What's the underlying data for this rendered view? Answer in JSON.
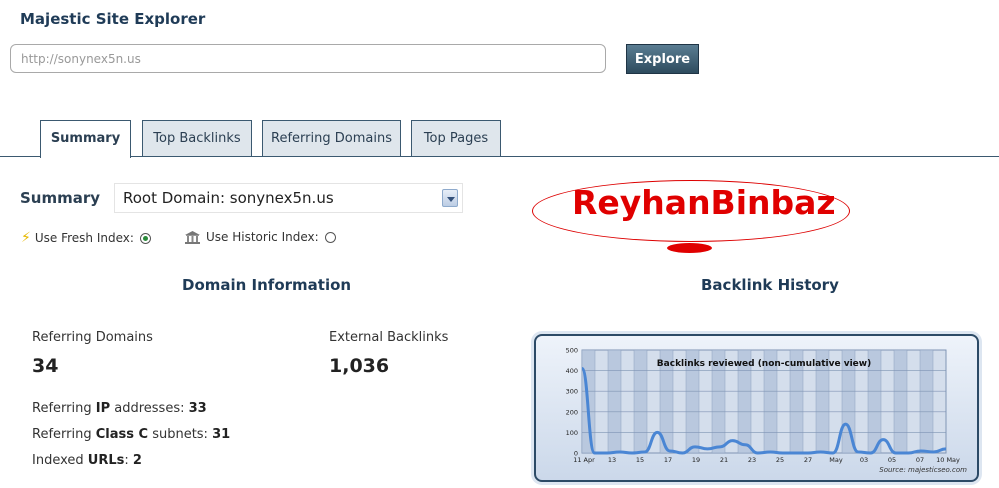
{
  "app": {
    "title": "Majestic Site Explorer"
  },
  "search": {
    "placeholder": "http://sonynex5n.us",
    "button_label": "Explore"
  },
  "tabs": [
    {
      "label": "Summary",
      "active": true
    },
    {
      "label": "Top Backlinks",
      "active": false
    },
    {
      "label": "Referring Domains",
      "active": false
    },
    {
      "label": "Top Pages",
      "active": false
    }
  ],
  "summary": {
    "label": "Summary",
    "selected_option": "Root Domain: sonynex5n.us",
    "fresh_index_label": "Use Fresh Index:",
    "historic_index_label": "Use Historic Index:",
    "fresh_selected": true
  },
  "watermark": {
    "text": "ReyhanBinbaz",
    "color": "#e00000"
  },
  "domain_info": {
    "title": "Domain Information",
    "referring_domains_label": "Referring Domains",
    "referring_domains_value": "34",
    "external_backlinks_label": "External Backlinks",
    "external_backlinks_value": "1,036",
    "ip_label": "Referring",
    "ip_bold": "IP",
    "ip_label2": "addresses:",
    "ip_value": "33",
    "classc_label": "Referring",
    "classc_bold": "Class C",
    "classc_label2": "subnets:",
    "classc_value": "31",
    "indexed_label": "Indexed",
    "indexed_bold": "URLs",
    "indexed_value": "2"
  },
  "backlink_history": {
    "title": "Backlink History",
    "source": "Source: majesticseo.com"
  },
  "colors": {
    "accent": "#1f3b57",
    "line": "#4a86d4",
    "button": "#3d5c70"
  },
  "chart_data": {
    "type": "line",
    "title": "Backlinks reviewed (non-cumulative view)",
    "x_tick_labels": [
      "11 Apr",
      "13",
      "15",
      "17",
      "19",
      "21",
      "23",
      "25",
      "27",
      "May",
      "03",
      "05",
      "07",
      "10 May"
    ],
    "y_tick_labels": [
      "0",
      "100",
      "200",
      "300",
      "400",
      "500"
    ],
    "ylim": [
      0,
      500
    ],
    "grid": true,
    "x": [
      0,
      1,
      2,
      3,
      4,
      5,
      6,
      7,
      8,
      9,
      10,
      11,
      12,
      13,
      14,
      15,
      16,
      17,
      18,
      19,
      20,
      21,
      22,
      23,
      24,
      25,
      26,
      27,
      28,
      29
    ],
    "values": [
      410,
      0,
      0,
      5,
      0,
      5,
      100,
      10,
      0,
      30,
      20,
      30,
      60,
      40,
      0,
      5,
      0,
      0,
      0,
      5,
      0,
      140,
      5,
      0,
      65,
      0,
      0,
      10,
      5,
      20
    ]
  }
}
